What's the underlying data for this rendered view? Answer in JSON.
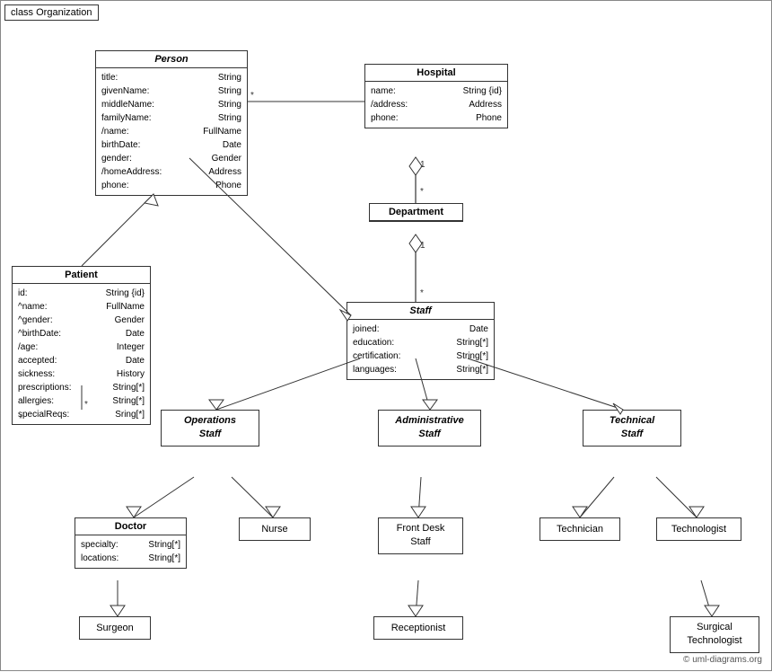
{
  "diagram": {
    "title": "class Organization",
    "copyright": "© uml-diagrams.org",
    "classes": {
      "person": {
        "name": "Person",
        "italic": true,
        "attributes": [
          {
            "label": "title:",
            "type": "String"
          },
          {
            "label": "givenName:",
            "type": "String"
          },
          {
            "label": "middleName:",
            "type": "String"
          },
          {
            "label": "familyName:",
            "type": "String"
          },
          {
            "label": "/name:",
            "type": "FullName"
          },
          {
            "label": "birthDate:",
            "type": "Date"
          },
          {
            "label": "gender:",
            "type": "Gender"
          },
          {
            "label": "/homeAddress:",
            "type": "Address"
          },
          {
            "label": "phone:",
            "type": "Phone"
          }
        ]
      },
      "hospital": {
        "name": "Hospital",
        "italic": false,
        "attributes": [
          {
            "label": "name:",
            "type": "String {id}"
          },
          {
            "label": "/address:",
            "type": "Address"
          },
          {
            "label": "phone:",
            "type": "Phone"
          }
        ]
      },
      "department": {
        "name": "Department",
        "italic": false,
        "attributes": []
      },
      "staff": {
        "name": "Staff",
        "italic": true,
        "attributes": [
          {
            "label": "joined:",
            "type": "Date"
          },
          {
            "label": "education:",
            "type": "String[*]"
          },
          {
            "label": "certification:",
            "type": "String[*]"
          },
          {
            "label": "languages:",
            "type": "String[*]"
          }
        ]
      },
      "patient": {
        "name": "Patient",
        "italic": false,
        "attributes": [
          {
            "label": "id:",
            "type": "String {id}"
          },
          {
            "label": "^name:",
            "type": "FullName"
          },
          {
            "label": "^gender:",
            "type": "Gender"
          },
          {
            "label": "^birthDate:",
            "type": "Date"
          },
          {
            "label": "/age:",
            "type": "Integer"
          },
          {
            "label": "accepted:",
            "type": "Date"
          },
          {
            "label": "sickness:",
            "type": "History"
          },
          {
            "label": "prescriptions:",
            "type": "String[*]"
          },
          {
            "label": "allergies:",
            "type": "String[*]"
          },
          {
            "label": "specialReqs:",
            "type": "Sring[*]"
          }
        ]
      },
      "operations_staff": {
        "name": "Operations\nStaff",
        "italic": true
      },
      "administrative_staff": {
        "name": "Administrative\nStaff",
        "italic": true
      },
      "technical_staff": {
        "name": "Technical\nStaff",
        "italic": true
      },
      "doctor": {
        "name": "Doctor",
        "italic": false,
        "attributes": [
          {
            "label": "specialty:",
            "type": "String[*]"
          },
          {
            "label": "locations:",
            "type": "String[*]"
          }
        ]
      },
      "nurse": {
        "name": "Nurse",
        "italic": false
      },
      "front_desk_staff": {
        "name": "Front Desk\nStaff",
        "italic": false
      },
      "technician": {
        "name": "Technician",
        "italic": false
      },
      "technologist": {
        "name": "Technologist",
        "italic": false
      },
      "surgeon": {
        "name": "Surgeon",
        "italic": false
      },
      "receptionist": {
        "name": "Receptionist",
        "italic": false
      },
      "surgical_technologist": {
        "name": "Surgical\nTechnologist",
        "italic": false
      }
    }
  }
}
